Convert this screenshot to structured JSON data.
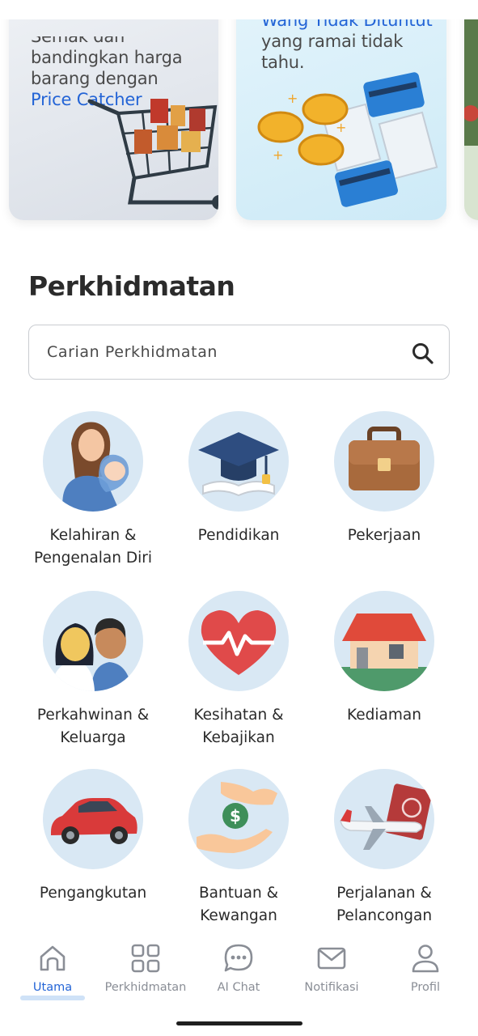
{
  "banners": [
    {
      "cut_line": "Semak dan",
      "lines": [
        "bandingkan harga",
        "barang dengan"
      ],
      "highlight": "Price Catcher"
    },
    {
      "highlight_title": "Wang Tidak Dituntut",
      "lines": [
        "yang ramai tidak",
        "tahu."
      ]
    }
  ],
  "section": {
    "title": "Perkhidmatan",
    "search_placeholder": "Carian Perkhidmatan"
  },
  "services": [
    {
      "label_1": "Kelahiran &",
      "label_2": "Pengenalan Diri",
      "icon": "mother-baby-icon"
    },
    {
      "label_1": "Pendidikan",
      "label_2": "",
      "icon": "graduation-cap-icon"
    },
    {
      "label_1": "Pekerjaan",
      "label_2": "",
      "icon": "briefcase-icon"
    },
    {
      "label_1": "Perkahwinan &",
      "label_2": "Keluarga",
      "icon": "couple-icon"
    },
    {
      "label_1": "Kesihatan &",
      "label_2": "Kebajikan",
      "icon": "heart-pulse-icon"
    },
    {
      "label_1": "Kediaman",
      "label_2": "",
      "icon": "house-icon"
    },
    {
      "label_1": "Pengangkutan",
      "label_2": "",
      "icon": "car-icon"
    },
    {
      "label_1": "Bantuan &",
      "label_2": "Kewangan",
      "icon": "money-hand-icon"
    },
    {
      "label_1": "Perjalanan &",
      "label_2": "Pelancongan",
      "icon": "plane-passport-icon"
    }
  ],
  "nav": [
    {
      "label": "Utama",
      "icon": "home-icon",
      "active": true
    },
    {
      "label": "Perkhidmatan",
      "icon": "grid-icon",
      "active": false
    },
    {
      "label": "AI Chat",
      "icon": "chat-icon",
      "active": false
    },
    {
      "label": "Notifikasi",
      "icon": "mail-icon",
      "active": false
    },
    {
      "label": "Profil",
      "icon": "profile-icon",
      "active": false
    }
  ],
  "colors": {
    "accent": "#2364d6",
    "nav_inactive": "#8a8e96",
    "icon_bg": "#d9e8f4"
  }
}
